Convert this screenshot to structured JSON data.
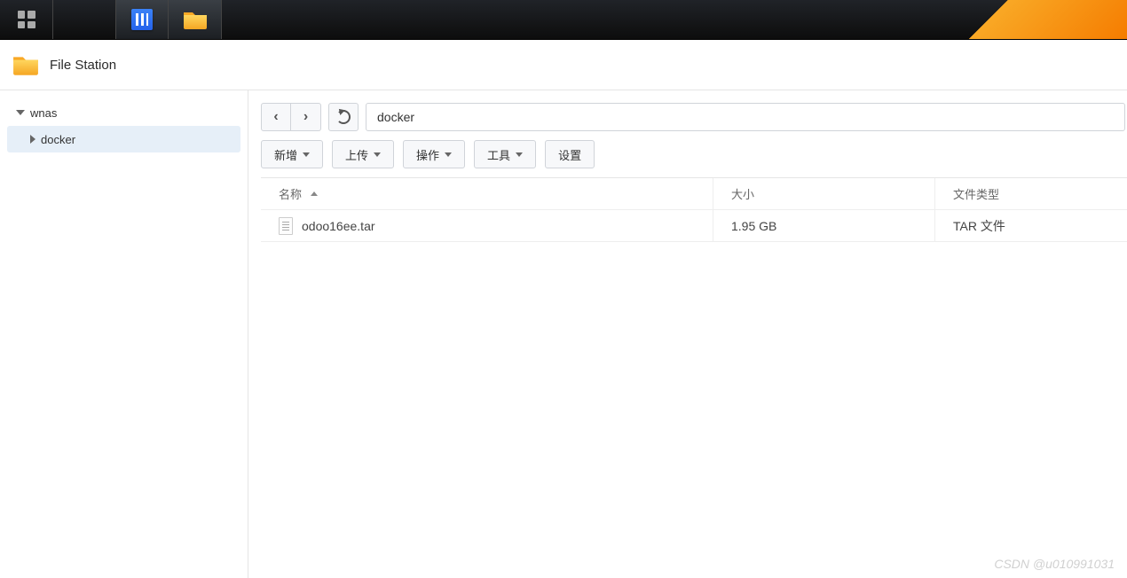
{
  "app_title": "File Station",
  "taskbar_items": [
    "apps",
    "control-panel",
    "file-station"
  ],
  "sidebar": {
    "root": {
      "label": "wnas",
      "expanded": true
    },
    "children": [
      {
        "label": "docker",
        "expanded": false,
        "selected": true
      }
    ]
  },
  "navigation": {
    "path": "docker"
  },
  "toolbar": {
    "new_label": "新增",
    "upload_label": "上传",
    "action_label": "操作",
    "tools_label": "工具",
    "settings_label": "设置"
  },
  "table": {
    "headers": {
      "name": "名称",
      "size": "大小",
      "type": "文件类型"
    },
    "sort_column": "name",
    "sort_dir": "asc",
    "rows": [
      {
        "name": "odoo16ee.tar",
        "size": "1.95 GB",
        "type": "TAR 文件"
      }
    ]
  },
  "watermark": "CSDN @u010991031"
}
